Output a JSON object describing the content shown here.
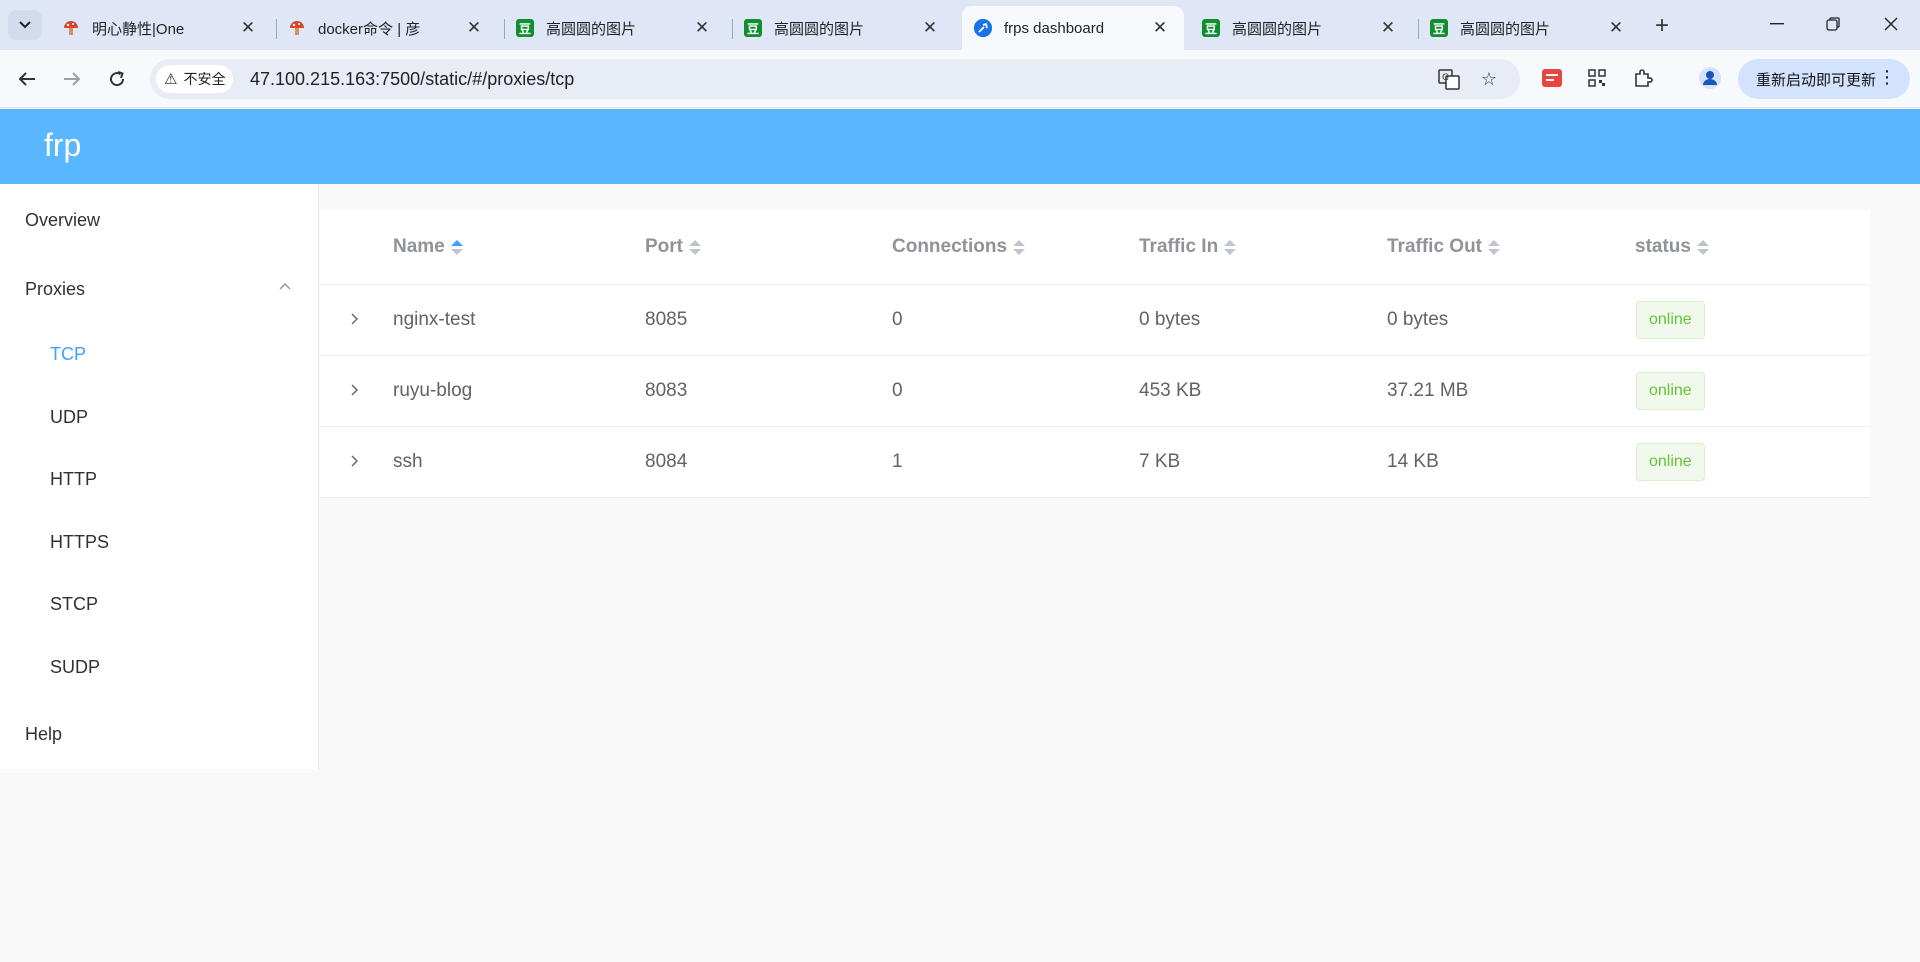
{
  "browser": {
    "tabs": [
      {
        "title": "明心静性|One",
        "icon": "mushroom-icon",
        "active": false
      },
      {
        "title": "docker命令 | 彦",
        "icon": "mushroom-icon",
        "active": false
      },
      {
        "title": "高圆圆的图片",
        "icon": "douban-icon",
        "active": false
      },
      {
        "title": "高圆圆的图片",
        "icon": "douban-icon",
        "active": false
      },
      {
        "title": "frps dashboard",
        "icon": "frp-icon",
        "active": true
      },
      {
        "title": "高圆圆的图片",
        "icon": "douban-icon",
        "active": false
      },
      {
        "title": "高圆圆的图片",
        "icon": "douban-icon",
        "active": false
      }
    ],
    "security_chip": "不安全",
    "url": "47.100.215.163:7500/static/#/proxies/tcp",
    "update_button": "重新启动即可更新",
    "douban_glyph": "豆"
  },
  "app": {
    "brand": "frp",
    "sidebar": {
      "overview": "Overview",
      "proxies": "Proxies",
      "sub_items": [
        "TCP",
        "UDP",
        "HTTP",
        "HTTPS",
        "STCP",
        "SUDP"
      ],
      "active_sub": "TCP",
      "help": "Help"
    },
    "table": {
      "columns": [
        "Name",
        "Port",
        "Connections",
        "Traffic In",
        "Traffic Out",
        "status"
      ],
      "sorted_column": "Name",
      "rows": [
        {
          "name": "nginx-test",
          "port": "8085",
          "connections": "0",
          "traffic_in": "0 bytes",
          "traffic_out": "0 bytes",
          "status": "online"
        },
        {
          "name": "ruyu-blog",
          "port": "8083",
          "connections": "0",
          "traffic_in": "453 KB",
          "traffic_out": "37.21 MB",
          "status": "online"
        },
        {
          "name": "ssh",
          "port": "8084",
          "connections": "1",
          "traffic_in": "7 KB",
          "traffic_out": "14 KB",
          "status": "online"
        }
      ]
    }
  },
  "colors": {
    "header": "#58b7ff",
    "active_link": "#409eff",
    "status_online": "#67c23a"
  }
}
